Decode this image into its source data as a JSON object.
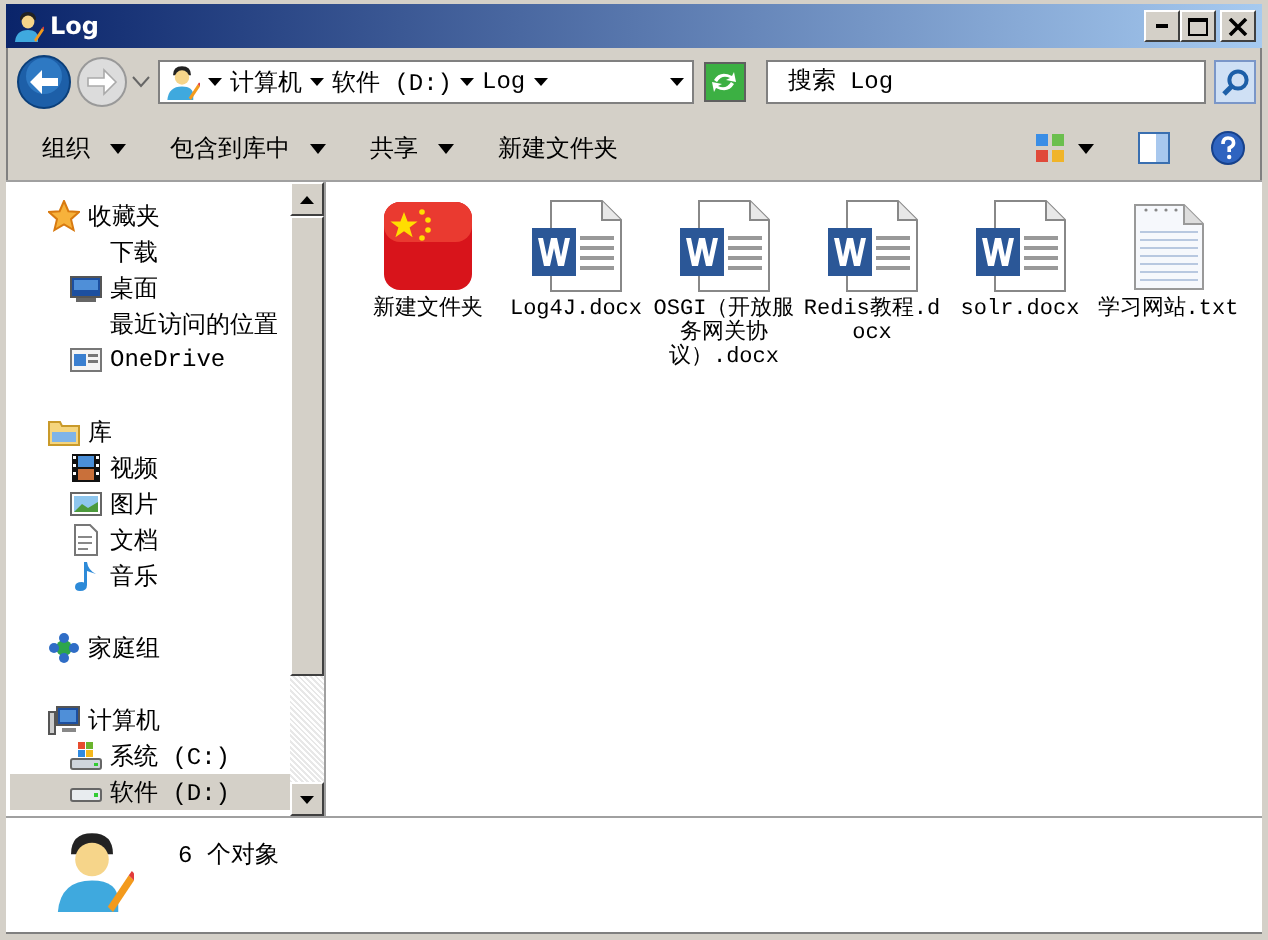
{
  "window": {
    "title": "Log"
  },
  "address": {
    "crumbs": [
      "计算机",
      "软件 (D:)",
      "Log"
    ]
  },
  "search": {
    "placeholder": "搜索 Log"
  },
  "toolbar": {
    "buttons": [
      {
        "label": "组织",
        "dropdown": true
      },
      {
        "label": "包含到库中",
        "dropdown": true
      },
      {
        "label": "共享",
        "dropdown": true
      },
      {
        "label": "新建文件夹",
        "dropdown": false
      }
    ]
  },
  "sidebar": {
    "groups": [
      {
        "label": "收藏夹",
        "kind": "star",
        "selected": false,
        "children": [
          {
            "label": "下载",
            "kind": "blank",
            "selected": false
          },
          {
            "label": "桌面",
            "kind": "desktop",
            "selected": false
          },
          {
            "label": "最近访问的位置",
            "kind": "blank",
            "selected": false
          },
          {
            "label": "OneDrive",
            "kind": "window",
            "selected": false
          }
        ]
      },
      {
        "label": "库",
        "kind": "library",
        "selected": false,
        "children": [
          {
            "label": "视频",
            "kind": "video",
            "selected": false
          },
          {
            "label": "图片",
            "kind": "picture",
            "selected": false
          },
          {
            "label": "文档",
            "kind": "document",
            "selected": false
          },
          {
            "label": "音乐",
            "kind": "music",
            "selected": false
          }
        ]
      },
      {
        "label": "家庭组",
        "kind": "homegroup",
        "selected": false
      },
      {
        "label": "计算机",
        "kind": "computer",
        "selected": false,
        "children": [
          {
            "label": "系统 (C:)",
            "kind": "system-drive",
            "selected": false
          },
          {
            "label": "软件 (D:)",
            "kind": "drive",
            "selected": true
          }
        ]
      }
    ]
  },
  "files": [
    {
      "name": "新建文件夹",
      "kind": "flag-folder"
    },
    {
      "name": "Log4J.docx",
      "kind": "word"
    },
    {
      "name": "OSGI（开放服务网关协议）.docx",
      "kind": "word"
    },
    {
      "name": "Redis教程.docx",
      "kind": "word"
    },
    {
      "name": "solr.docx",
      "kind": "word"
    },
    {
      "name": "学习网站.txt",
      "kind": "text"
    }
  ],
  "status": {
    "text": "6 个对象"
  }
}
